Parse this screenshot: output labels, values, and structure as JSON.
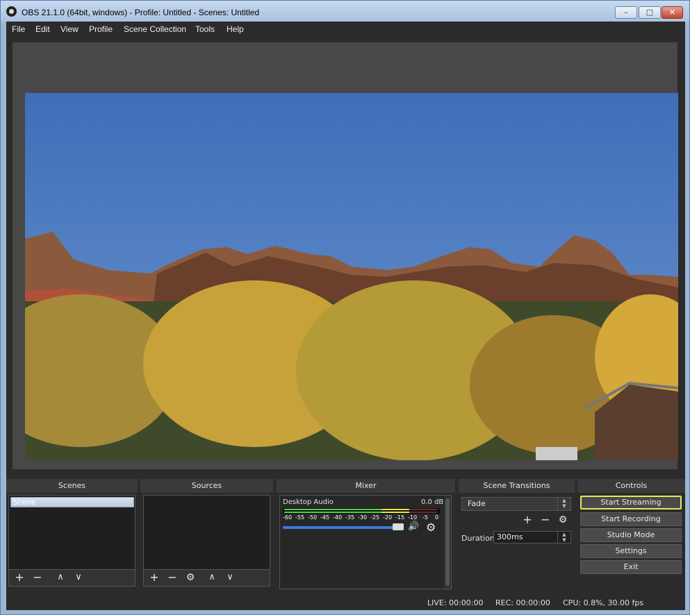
{
  "window": {
    "title": "OBS 21.1.0 (64bit, windows) - Profile: Untitled - Scenes: Untitled",
    "buttons": {
      "minimize": "–",
      "maximize": "□",
      "close": "✕"
    }
  },
  "menu": {
    "items": [
      "File",
      "Edit",
      "View",
      "Profile",
      "Scene Collection",
      "Tools",
      "Help"
    ]
  },
  "docks": {
    "scenes": {
      "title": "Scenes",
      "items": [
        "Scene"
      ]
    },
    "sources": {
      "title": "Sources"
    },
    "mixer": {
      "title": "Mixer",
      "channel_name": "Desktop Audio",
      "channel_db": "0.0 dB",
      "scale": [
        "-60",
        "-55",
        "-50",
        "-45",
        "-40",
        "-35",
        "-30",
        "-25",
        "-20",
        "-15",
        "-10",
        "-5",
        "0"
      ],
      "volume_fraction": 1.0
    },
    "transitions": {
      "title": "Scene Transitions",
      "selected": "Fade",
      "duration_label": "Duration",
      "duration_value": "300ms"
    },
    "controls": {
      "title": "Controls",
      "buttons": [
        "Start Streaming",
        "Start Recording",
        "Studio Mode",
        "Settings",
        "Exit"
      ]
    }
  },
  "status": {
    "live": "LIVE: 00:00:00",
    "rec": "REC: 00:00:00",
    "cpu": "CPU: 0.8%, 30.00 fps"
  },
  "icons": {
    "add": "+",
    "remove": "−",
    "up": "∧",
    "down": "∨",
    "gear": "⚙",
    "speaker": "🔊"
  },
  "colors": {
    "panel_bg": "#2b2b2b",
    "preview_bg": "#484848",
    "focus_border": "#e8e85a",
    "meter_green": "#4bd64b",
    "meter_yellow": "#e8e84b",
    "meter_red": "#d64b4b",
    "volume_blue": "#3c7bd8"
  }
}
